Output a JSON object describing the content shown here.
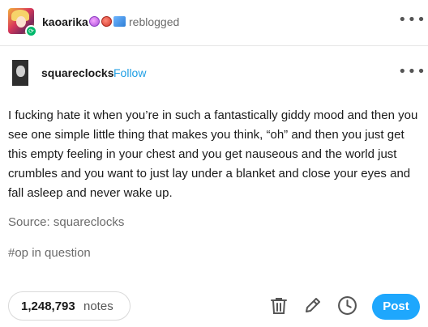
{
  "reblog": {
    "username": "kaoarika",
    "action_text": "reblogged",
    "avatar_icon": "anime-character-avatar",
    "badge_icons": [
      "purple-badge-icon",
      "red-badge-icon",
      "blue-badge-icon"
    ],
    "reblog_indicator_icon": "reblog-icon",
    "reblog_glyph": "⟳",
    "more_label": "•••"
  },
  "author": {
    "username": "squareclocks",
    "follow_label": "Follow",
    "avatar_icon": "person-portrait-avatar",
    "more_label": "•••"
  },
  "post": {
    "body": "I fucking hate it when you’re in such a fantastically giddy mood and then you see one simple little thing that makes you think, “oh” and then you just get this empty feeling in your chest and you get nauseous and the world just crumbles and you want to just lay under a blanket and close your eyes and fall asleep and never wake up.",
    "source": "Source: squareclocks",
    "tag": "#op in question"
  },
  "footer": {
    "notes_count": "1,248,793",
    "notes_label": "notes",
    "icons": [
      "trash-icon",
      "pencil-icon",
      "clock-icon"
    ],
    "post_label": "Post"
  },
  "colors": {
    "accent_blue": "#1ea7fd",
    "follow_blue": "#1e9ee4",
    "reblog_green": "#00b86b",
    "muted_text": "#6b6b6b"
  }
}
